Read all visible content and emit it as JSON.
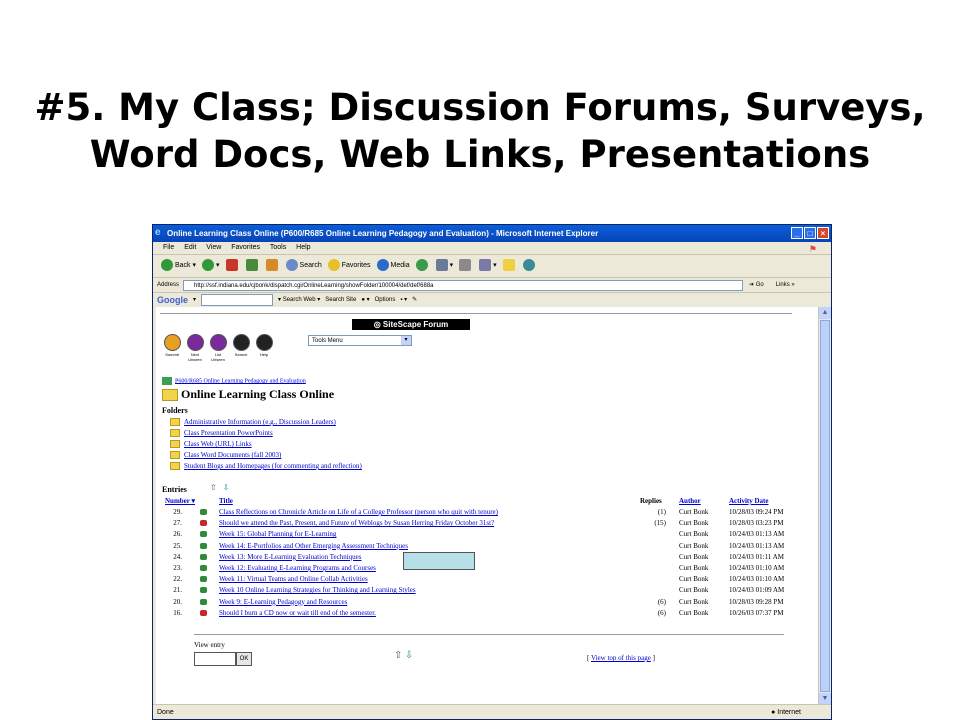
{
  "slide": {
    "title_line1": "#5. My Class; Discussion Forums, Surveys,",
    "title_line2": "Word Docs, Web Links, Presentations"
  },
  "browser": {
    "window_title": "Online Learning Class Online (P600/R685 Online Learning Pedagogy and Evaluation) - Microsoft Internet Explorer",
    "menu": [
      "File",
      "Edit",
      "View",
      "Favorites",
      "Tools",
      "Help"
    ],
    "toolbar": {
      "back": "Back",
      "search": "Search",
      "favorites": "Favorites",
      "media": "Media"
    },
    "address_label": "Address",
    "address_url": "http://ssf.indiana.edu/cjbonk/dispatch.cgi/OnlineLearning/showFolder/100004/def/def/688a",
    "go_label": "Go",
    "links_label": "Links",
    "google": {
      "logo": "Google",
      "search_web": "Search Web",
      "search_site": "Search Site",
      "options": "Options"
    },
    "status_left": "Done",
    "status_zone": "Internet"
  },
  "forum": {
    "logo": "SiteScape Forum",
    "nav_icons": [
      {
        "name": "summit",
        "label": "Summit"
      },
      {
        "name": "next-unseen",
        "label": "Next Unseen"
      },
      {
        "name": "list-unseen",
        "label": "List Unseen"
      },
      {
        "name": "search",
        "label": "Search"
      },
      {
        "name": "help",
        "label": "Help"
      }
    ],
    "tools_menu": "Tools Menu",
    "breadcrumb": "P600/R685 Online Learning Pedagogy and Evaluation",
    "folder_title": "Online Learning Class Online",
    "folders_label": "Folders",
    "folders": [
      "Administrative Information (e.g., Discussion Leaders)",
      "Class Presentation PowerPoints",
      "Class Web (URL) Links",
      "Class Word Documents (fall 2003)",
      "Student Blogs and Homepages (for commenting and reflection)"
    ],
    "entries_label": "Entries",
    "columns": {
      "number": "Number",
      "title": "Title",
      "replies": "Replies",
      "author": "Author",
      "date": "Activity Date"
    },
    "entries": [
      {
        "num": "29.",
        "title": "Class Reflections on Chronicle Article on Life of a College Professor (person who quit with tenure)",
        "replies": "(1)",
        "author": "Curt Bonk",
        "date": "10/28/03 09:24 PM",
        "icon_color": "#2e8b3a"
      },
      {
        "num": "27.",
        "title": "Should we attend the Past, Present, and Future of Weblogs by Susan Herring Friday October 31st?",
        "replies": "(15)",
        "author": "Curt Bonk",
        "date": "10/28/03 03:23 PM",
        "icon_color": "#c8262b"
      },
      {
        "num": "26.",
        "title": "Week 15: Global Planning for E-Learning",
        "replies": "",
        "author": "Curt Bonk",
        "date": "10/24/03 01:13 AM",
        "icon_color": "#2e8b3a"
      },
      {
        "num": "25.",
        "title": "Week 14: E-Portfolios and Other Emerging Assessment Techniques",
        "replies": "",
        "author": "Curt Bonk",
        "date": "10/24/03 01:13 AM",
        "icon_color": "#2e8b3a"
      },
      {
        "num": "24.",
        "title": "Week 13: More E-Learning Evaluation Techniques",
        "replies": "",
        "author": "Curt Bonk",
        "date": "10/24/03 01:11 AM",
        "icon_color": "#2e8b3a"
      },
      {
        "num": "23.",
        "title": "Week 12: Evaluating E-Learning Programs and Courses",
        "replies": "",
        "author": "Curt Bonk",
        "date": "10/24/03 01:10 AM",
        "icon_color": "#2e8b3a"
      },
      {
        "num": "22.",
        "title": "Week 11: Virtual Teams and Online Collab Activities",
        "replies": "",
        "author": "Curt Bonk",
        "date": "10/24/03 01:10 AM",
        "icon_color": "#2e8b3a"
      },
      {
        "num": "21.",
        "title": "Week 10 Online Learning Strategies for Thinking and Learning Styles",
        "replies": "",
        "author": "Curt Bonk",
        "date": "10/24/03 01:09 AM",
        "icon_color": "#2e8b3a"
      },
      {
        "num": "20.",
        "title": "Week 9: E-Learning Pedagogy and Resources",
        "replies": "(6)",
        "author": "Curt Bonk",
        "date": "10/28/03 09:28 PM",
        "icon_color": "#2e8b3a"
      },
      {
        "num": "16.",
        "title": "Should I burn a CD now or wait till end of the semester.",
        "replies": "(6)",
        "author": "Curt Bonk",
        "date": "10/26/03 07:37 PM",
        "icon_color": "#c8262b"
      }
    ],
    "view_entry_label": "View entry",
    "ok_label": "OK",
    "view_top": "View top of this page"
  }
}
